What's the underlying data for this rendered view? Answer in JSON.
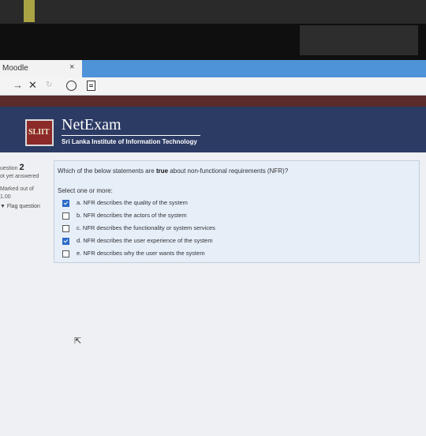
{
  "browser": {
    "tab_title": "Moodle",
    "tab_close": "×",
    "back": "→",
    "close": "✕",
    "reload": "↻",
    "info_icon": "ⓘ"
  },
  "header": {
    "logo_text": "SLIIT",
    "brand": "NetExam",
    "subtitle": "Sri Lanka Institute of Information Technology"
  },
  "question_info": {
    "label": "uestion",
    "number": "2",
    "status": "ot yet answered",
    "marked": "Marked out of",
    "marks": "1.00",
    "flag": "▼ Flag question"
  },
  "question": {
    "text_before": "Which of the below statements are ",
    "emphasis": "true",
    "text_after": " about non-functional requirements (NFR)?",
    "prompt": "Select one or more:",
    "options": [
      {
        "label": "a. NFR describes the quality of the system",
        "checked": true
      },
      {
        "label": "b. NFR describes the actors of the system",
        "checked": false
      },
      {
        "label": "c. NFR describes the functionality or system services",
        "checked": false
      },
      {
        "label": "d. NFR describes the user experience of the system",
        "checked": true
      },
      {
        "label": "e. NFR describes why the user wants the system",
        "checked": false
      }
    ]
  },
  "colors": {
    "header_bg": "#2c3b64",
    "tab_bar": "#4e93d8",
    "checkbox_checked": "#2b6cc7"
  }
}
